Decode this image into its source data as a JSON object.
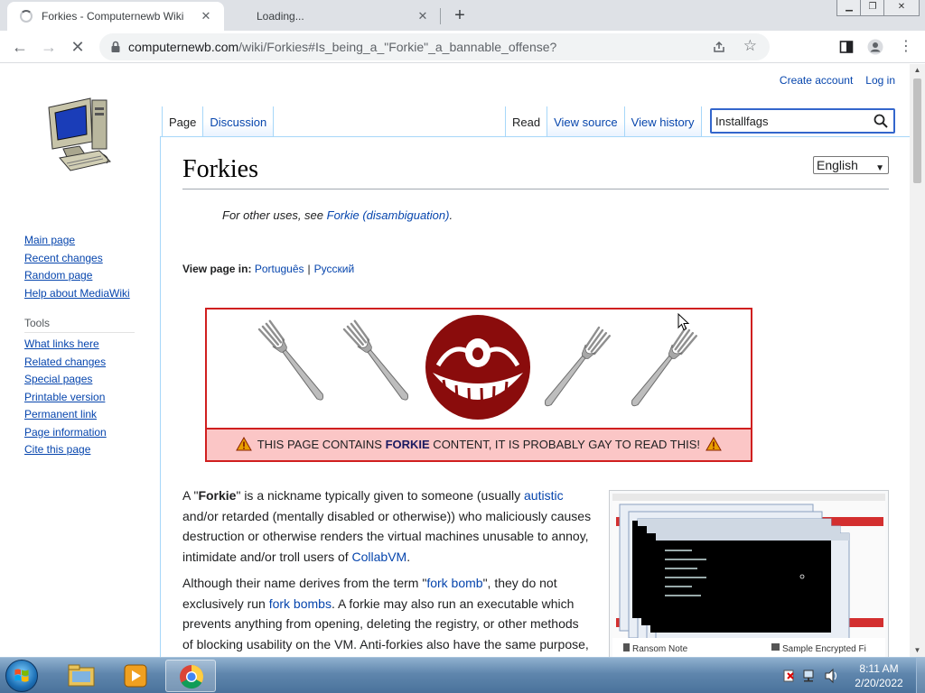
{
  "browser": {
    "tabs": [
      {
        "title": "Forkies - Computernewb Wiki",
        "active": true
      },
      {
        "title": "Loading...",
        "active": false
      }
    ],
    "url_host": "computernewb.com",
    "url_path": "/wiki/Forkies#Is_being_a_\"Forkie\"_a_bannable_offense?",
    "icons": {
      "back": "arrow-left-icon",
      "forward": "arrow-right-icon",
      "stop": "close-icon",
      "lock": "lock-icon",
      "share": "share-icon",
      "bookmark": "star-icon",
      "sidepanel": "side-panel-icon",
      "profile": "profile-icon",
      "menu": "kebab-menu-icon"
    }
  },
  "wiki": {
    "personal": {
      "create_account": "Create account",
      "log_in": "Log in"
    },
    "sidebar": {
      "nav": [
        "Main page",
        "Recent changes",
        "Random page",
        "Help about MediaWiki"
      ],
      "tools_heading": "Tools",
      "tools": [
        "What links here",
        "Related changes",
        "Special pages",
        "Printable version",
        "Permanent link",
        "Page information",
        "Cite this page"
      ]
    },
    "tabs_left": [
      "Page",
      "Discussion"
    ],
    "tabs_right": [
      "Read",
      "View source",
      "View history"
    ],
    "search_value": "Installfags",
    "title": "Forkies",
    "language_select": "English",
    "hatnote": {
      "prefix": "For other uses, see ",
      "link": "Forkie (disambiguation)",
      "suffix": "."
    },
    "view_in": {
      "label": "View page in:",
      "langs": [
        "Português",
        "Русский"
      ]
    },
    "banner": {
      "pre": "THIS PAGE CONTAINS ",
      "strong": "FORKIE",
      "post": " CONTENT, IT IS PROBABLY GAY TO READ THIS!"
    },
    "para1": {
      "t1": "A \"",
      "b1": "Forkie",
      "t2": "\" is a nickname typically given to someone (usually ",
      "l1": "autistic",
      "t3": " and/or retarded (mentally disabled or otherwise)) who maliciously causes destruction or otherwise renders the virtual machines unusable to annoy, intimidate and/or troll users of ",
      "l2": "CollabVM",
      "t4": "."
    },
    "para2": {
      "t1": "Although their name derives from the term \"",
      "l1": "fork bomb",
      "t2": "\", they do not exclusively run ",
      "l2": "fork bombs",
      "t3": ". A forkie may also run an executable which prevents anything from opening, deleting the registry, or other methods of blocking usability on the VM. Anti-forkies also have the same purpose,"
    },
    "thumbnail_labels": {
      "left": "Ransom Note",
      "right": "Sample Encrypted Fi"
    }
  },
  "taskbar": {
    "time": "8:11 AM",
    "date": "2/20/2022"
  }
}
